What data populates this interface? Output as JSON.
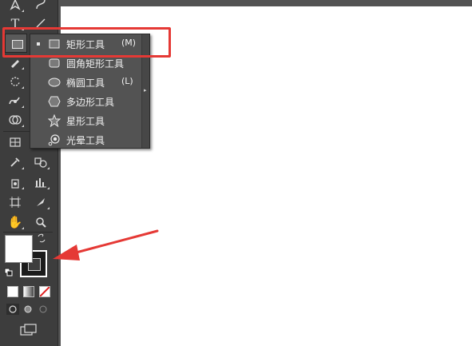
{
  "app": {
    "accent_color": "#e53935"
  },
  "flyout": {
    "items": [
      {
        "label": "矩形工具",
        "shortcut": "(M)",
        "icon": "rectangle-icon",
        "selected": true
      },
      {
        "label": "圆角矩形工具",
        "shortcut": "",
        "icon": "rounded-rectangle-icon",
        "selected": false
      },
      {
        "label": "椭圆工具",
        "shortcut": "(L)",
        "icon": "ellipse-icon",
        "selected": false
      },
      {
        "label": "多边形工具",
        "shortcut": "",
        "icon": "polygon-icon",
        "selected": false
      },
      {
        "label": "星形工具",
        "shortcut": "",
        "icon": "star-icon",
        "selected": false
      },
      {
        "label": "光晕工具",
        "shortcut": "",
        "icon": "flare-icon",
        "selected": false
      }
    ]
  },
  "toolbar": {
    "type_tool_glyph": "T",
    "colors": {
      "fill": "#ffffff",
      "stroke": "#1c1c1c"
    }
  }
}
